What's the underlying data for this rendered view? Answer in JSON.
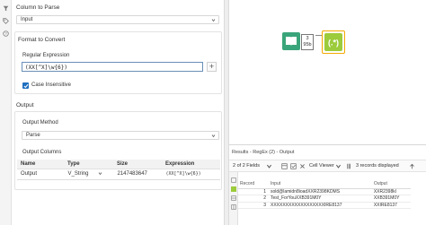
{
  "left_strip": {
    "icons": [
      "filter-icon",
      "tag-icon",
      "help-icon"
    ]
  },
  "config": {
    "column_to_parse": {
      "title": "Column to Parse",
      "value": "Input"
    },
    "format_to_convert": {
      "title": "Format to Convert",
      "regex_label": "Regular Expression",
      "regex_value": "(XX[^X]\\w{6})",
      "case_insensitive_label": "Case Insensitive",
      "case_insensitive_checked": true
    },
    "output": {
      "title": "Output",
      "method_label": "Output Method",
      "method_value": "Parse",
      "columns_label": "Output Columns",
      "table": {
        "headers": [
          "Name",
          "Type",
          "Size",
          "Expression"
        ],
        "rows": [
          [
            "Output",
            "V_String",
            "2147483647",
            "(XX[^X]\\w{6})"
          ]
        ]
      }
    }
  },
  "canvas": {
    "input_tool_badge_lines": [
      "3",
      "95b"
    ]
  },
  "results": {
    "title": "Results - RegEx (2) - Output",
    "fields_text": "2 of 2 Fields",
    "cell_viewer": "Cell Viewer",
    "records_text": "3 records displayed",
    "table": {
      "headers": [
        "Record",
        "Input",
        "Output"
      ],
      "rows": [
        [
          "1",
          "sold@lamidn8ioadXXR2398KDMS",
          "XXR2398kl"
        ],
        [
          "2",
          "Test_ForYouXXB391M0Y",
          "XXB391M0Y"
        ],
        [
          "3",
          "XXXXXXXXXXXXXXXXXXIRE8137",
          "XXIRE8137"
        ]
      ]
    }
  },
  "colors": {
    "accent": "#1f6fbf",
    "tool_green": "#3aa57a",
    "tool_lime": "#9ccb3b",
    "tool_yellow": "#f2a900"
  }
}
